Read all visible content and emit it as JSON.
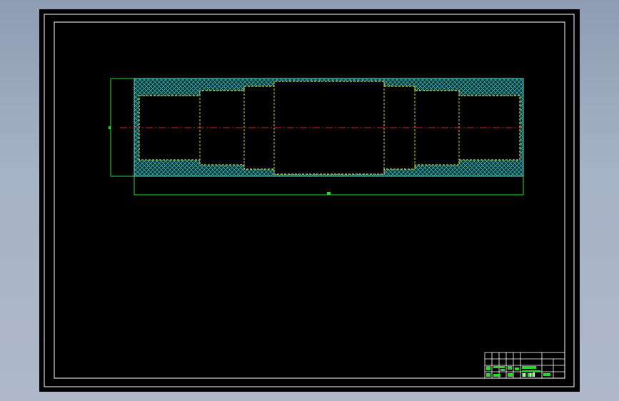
{
  "app": {
    "title": "",
    "viewport": {
      "background": "#000000"
    }
  },
  "drawing": {
    "colors": {
      "frame": "#ffffff",
      "part_outline": "#cccc33",
      "hatch_fill": "#0b3a3a",
      "hatch_lines": "#3fa6a6",
      "hatch_border": "#4fd6d6",
      "centerline": "#cc2222",
      "dimension": "#22dd22",
      "title_block": "#ffffff",
      "title_block_text": "#22dd22"
    },
    "part": {
      "type": "stepped shaft in sleeve, sectioned",
      "steps": 7,
      "hatched": true,
      "centerline": true
    },
    "dimensions": {
      "overall_length_label": "",
      "overall_diameter_label": ""
    },
    "title_block": {
      "rows": 4,
      "filled_cells": true
    }
  }
}
